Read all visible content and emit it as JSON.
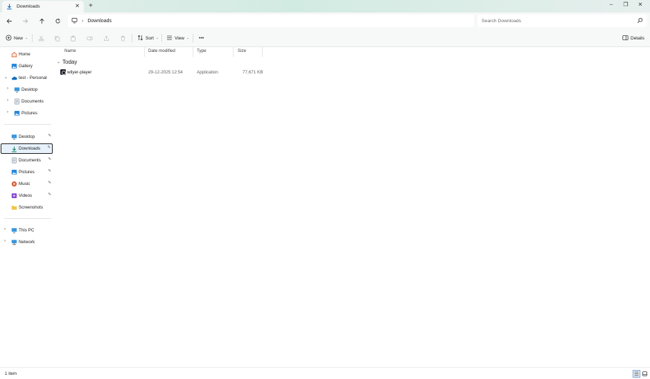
{
  "window": {
    "tab_title": "Downloads",
    "tab_close": "✕",
    "new_tab": "+",
    "controls": [
      "–",
      "❐",
      "✕"
    ]
  },
  "address": {
    "crumbs": [
      "Downloads"
    ],
    "search_placeholder": "Search Downloads"
  },
  "toolbar": {
    "new_label": "New",
    "sort_label": "Sort",
    "view_label": "View",
    "more_label": "•••",
    "details_label": "Details"
  },
  "sidebar": {
    "home": "Home",
    "gallery": "Gallery",
    "onedrive": "test - Personal",
    "onedrive_children": [
      "Desktop",
      "Documents",
      "Pictures"
    ],
    "quick_access": [
      "Desktop",
      "Downloads",
      "Documents",
      "Pictures",
      "Music",
      "Videos",
      "Screenshots"
    ],
    "this_pc": "This PC",
    "network": "Network"
  },
  "content": {
    "columns": [
      "Name",
      "Date modified",
      "Type",
      "Size"
    ],
    "group_label": "Today",
    "rows": [
      {
        "name": "wilyer-player",
        "date": "29-12-2025 12:54",
        "type": "Application",
        "size": "77,671 KB"
      }
    ]
  },
  "status": {
    "item_count": "1 item"
  },
  "colors": {
    "accent": "#0067c0",
    "selection_bg": "#e6f1fb",
    "titlebar_tint": "#d2ebe2"
  }
}
